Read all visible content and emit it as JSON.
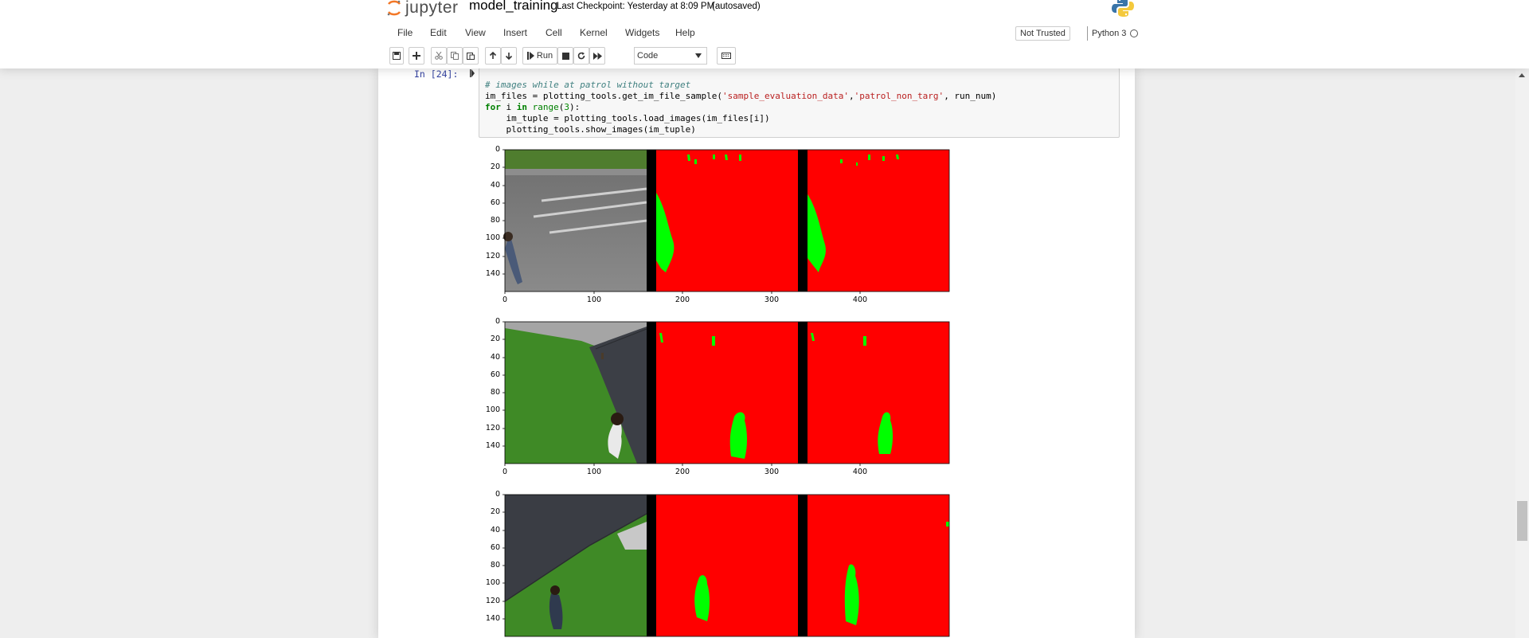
{
  "header": {
    "logo_text": "jupyter",
    "notebook_name": "model_training",
    "checkpoint": "Last Checkpoint: Yesterday at 8:09 PM",
    "autosave": "(autosaved)"
  },
  "menu": {
    "items": [
      "File",
      "Edit",
      "View",
      "Insert",
      "Cell",
      "Kernel",
      "Widgets",
      "Help"
    ],
    "trusted": "Not Trusted",
    "kernel": "Python 3"
  },
  "toolbar": {
    "run_label": "Run",
    "cell_type": "Code"
  },
  "cell": {
    "prompt": "In [24]:",
    "code_lines": [
      "# images while at patrol without target",
      "im_files = plotting_tools.get_im_file_sample('sample_evaluation_data','patrol_non_targ', run_num)",
      "for i in range(3):",
      "    im_tuple = plotting_tools.load_images(im_files[i])",
      "    plotting_tools.show_images(im_tuple)"
    ]
  },
  "plots": {
    "y_ticks": [
      "0",
      "20",
      "40",
      "60",
      "80",
      "100",
      "120",
      "140"
    ],
    "x_ticks": [
      "0",
      "100",
      "200",
      "300",
      "400"
    ],
    "colors": {
      "background": "#ff0000",
      "segment": "#00ff00",
      "divider": "#000000"
    }
  }
}
